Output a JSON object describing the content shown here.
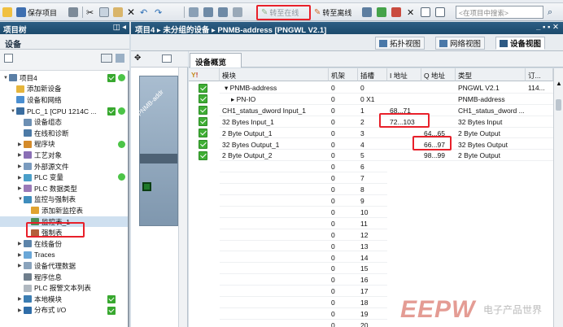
{
  "toolbar": {
    "save_project": "保存项目",
    "go_online": "转至在线",
    "go_offline": "转至离线",
    "search_placeholder": "<在项目中搜索>"
  },
  "left_panel": {
    "title": "项目树",
    "devices_label": "设备",
    "tree": [
      {
        "label": "项目4",
        "level": 0,
        "check": true,
        "dot": true
      },
      {
        "label": "添加新设备",
        "level": 1
      },
      {
        "label": "设备和网络",
        "level": 1
      },
      {
        "label": "PLC_1 [CPU 1214C ...",
        "level": 1,
        "check": true,
        "dot": true
      },
      {
        "label": "设备组态",
        "level": 2
      },
      {
        "label": "在线和诊断",
        "level": 2
      },
      {
        "label": "程序块",
        "level": 2,
        "dot": true
      },
      {
        "label": "工艺对象",
        "level": 2
      },
      {
        "label": "外部源文件",
        "level": 2
      },
      {
        "label": "PLC 变量",
        "level": 2,
        "dot": true
      },
      {
        "label": "PLC 数据类型",
        "level": 2
      },
      {
        "label": "监控与强制表",
        "level": 2
      },
      {
        "label": "添加新监控表",
        "level": 3
      },
      {
        "label": "监控表_1",
        "level": 3
      },
      {
        "label": "强制表",
        "level": 3
      },
      {
        "label": "在线备份",
        "level": 2
      },
      {
        "label": "Traces",
        "level": 2
      },
      {
        "label": "设备代理数据",
        "level": 2
      },
      {
        "label": "程序信息",
        "level": 2
      },
      {
        "label": "PLC 报警文本列表",
        "level": 2
      },
      {
        "label": "本地模块",
        "level": 2,
        "check": true
      },
      {
        "label": "分布式 I/O",
        "level": 2,
        "check": true
      }
    ]
  },
  "main": {
    "breadcrumb": "项目4 ▸ 未分组的设备 ▸ PNMB-address [PNGWL V2.1]",
    "views": [
      "拓扑视图",
      "网络视图",
      "设备视图"
    ],
    "overview_tab": "设备概览",
    "graph_label": "PNMB-addr",
    "columns": [
      "模块",
      "机架",
      "插槽",
      "I 地址",
      "Q 地址",
      "类型",
      "订..."
    ],
    "rows": [
      {
        "module": "▾ PNMB-address",
        "rack": "0",
        "slot": "0",
        "i": "",
        "q": "",
        "type": "PNGWL V2.1",
        "order": "114...",
        "check": true
      },
      {
        "module": "▸ PN-IO",
        "rack": "0",
        "slot": "0 X1",
        "i": "",
        "q": "",
        "type": "PNMB-address",
        "order": "",
        "check": true
      },
      {
        "module": "CH1_status_dword Input_1",
        "rack": "0",
        "slot": "1",
        "i": "68...71",
        "q": "",
        "type": "CH1_status_dword ...",
        "order": "",
        "check": true
      },
      {
        "module": "32 Bytes Input_1",
        "rack": "0",
        "slot": "2",
        "i": "72...103",
        "q": "",
        "type": "32 Bytes Input",
        "order": "",
        "check": true
      },
      {
        "module": "2 Byte Output_1",
        "rack": "0",
        "slot": "3",
        "i": "",
        "q": "64...65",
        "type": "2 Byte Output",
        "order": "",
        "check": true
      },
      {
        "module": "32 Bytes Output_1",
        "rack": "0",
        "slot": "4",
        "i": "",
        "q": "66...97",
        "type": "32 Bytes Output",
        "order": "",
        "check": true
      },
      {
        "module": "2 Byte Output_2",
        "rack": "0",
        "slot": "5",
        "i": "",
        "q": "98...99",
        "type": "2 Byte Output",
        "order": "",
        "check": true
      },
      {
        "module": "",
        "rack": "0",
        "slot": "6"
      },
      {
        "module": "",
        "rack": "0",
        "slot": "7"
      },
      {
        "module": "",
        "rack": "0",
        "slot": "8"
      },
      {
        "module": "",
        "rack": "0",
        "slot": "9"
      },
      {
        "module": "",
        "rack": "0",
        "slot": "10"
      },
      {
        "module": "",
        "rack": "0",
        "slot": "11"
      },
      {
        "module": "",
        "rack": "0",
        "slot": "12"
      },
      {
        "module": "",
        "rack": "0",
        "slot": "13"
      },
      {
        "module": "",
        "rack": "0",
        "slot": "14"
      },
      {
        "module": "",
        "rack": "0",
        "slot": "15"
      },
      {
        "module": "",
        "rack": "0",
        "slot": "16"
      },
      {
        "module": "",
        "rack": "0",
        "slot": "17"
      },
      {
        "module": "",
        "rack": "0",
        "slot": "18"
      },
      {
        "module": "",
        "rack": "0",
        "slot": "19"
      },
      {
        "module": "",
        "rack": "0",
        "slot": "20"
      }
    ]
  },
  "watermark": {
    "brand": "EEPW",
    "sub": "电子产品世界"
  },
  "colors": {
    "header_blue": "#1b4a6c",
    "check_green": "#3fae34",
    "highlight_red": "#e8202a"
  }
}
